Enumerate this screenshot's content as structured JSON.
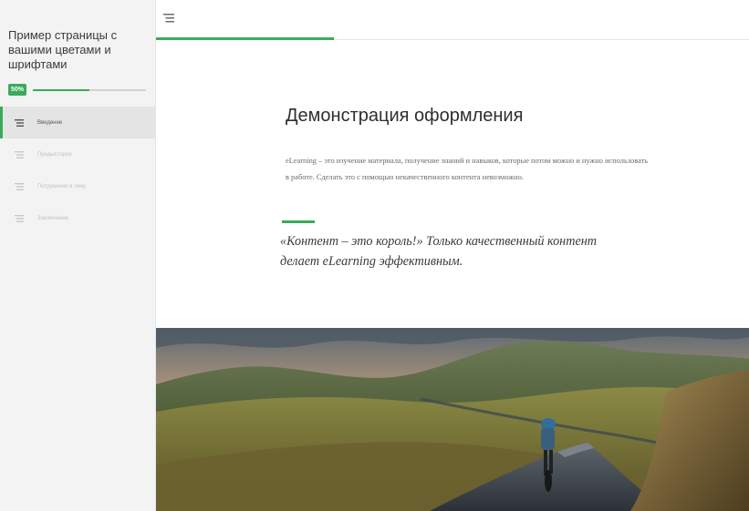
{
  "sidebar": {
    "course_title": "Пример страницы с вашими цветами и шрифтами",
    "progress": {
      "label": "50%",
      "value": 0.5
    },
    "items": [
      {
        "label": "Введение",
        "active": true
      },
      {
        "label": "Предыстория",
        "active": false
      },
      {
        "label": "Погружение в тему",
        "active": false
      },
      {
        "label": "Заключение",
        "active": false
      }
    ]
  },
  "topbar": {
    "menu_icon": "menu-list-icon",
    "lesson_progress": 0.3
  },
  "lesson": {
    "title": "Демонстрация оформления",
    "body": "eLearning – это изучение материала, получение знаний и навыков, которые потом можно и нужно использовать в работе. Сделать это с помощью некачественного контента невозможно.",
    "quote": "«Контент – это король!» Только качественный контент делает eLearning эффективным."
  },
  "colors": {
    "accent": "#3aaa5c",
    "sidebar_bg": "#f3f3f3",
    "text": "#2e2e2e"
  }
}
